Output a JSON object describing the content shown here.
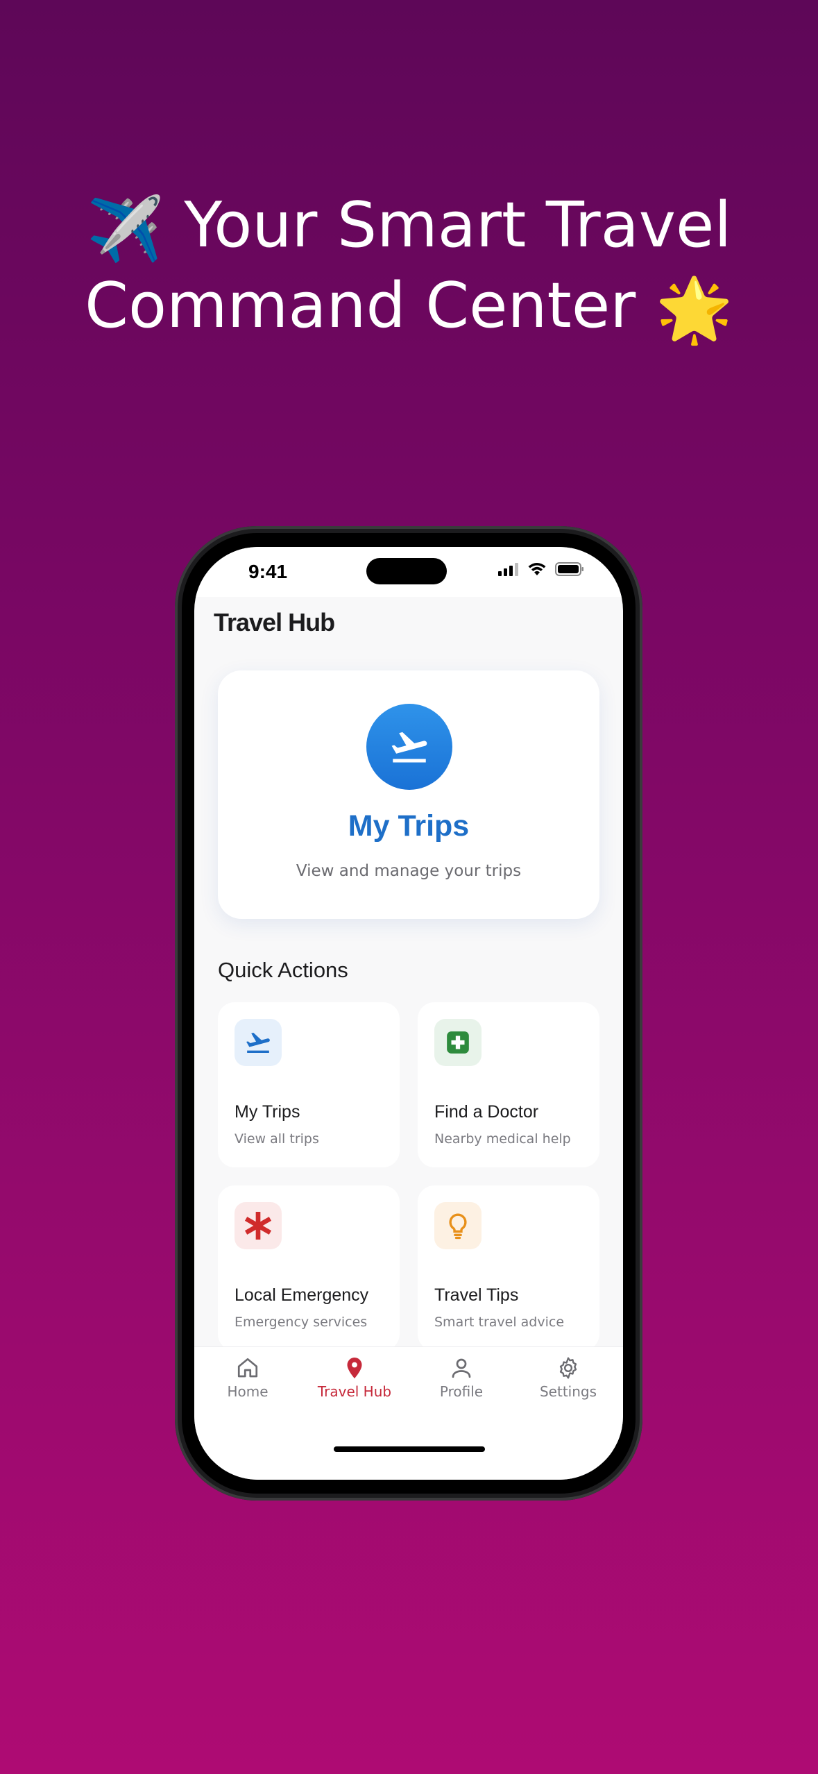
{
  "promo": {
    "headline_line1": "Your Smart Travel",
    "headline_line2": "Command Center",
    "emoji_start": "✈️",
    "emoji_end": "🌟"
  },
  "status_bar": {
    "time": "9:41"
  },
  "app": {
    "title": "Travel Hub"
  },
  "hero_card": {
    "title": "My Trips",
    "subtitle": "View and manage your trips",
    "icon": "airplane-departure-icon",
    "accent_color": "#1e6fc8"
  },
  "quick_actions": {
    "title": "Quick Actions",
    "items": [
      {
        "title": "My Trips",
        "subtitle": "View all trips",
        "icon": "airplane-departure-icon",
        "color": "#1e6fc8",
        "bg": "#e6f0fb"
      },
      {
        "title": "Find a Doctor",
        "subtitle": "Nearby medical help",
        "icon": "medical-cross-icon",
        "color": "#2e8b3d",
        "bg": "#e8f3ea"
      },
      {
        "title": "Local Emergency",
        "subtitle": "Emergency services",
        "icon": "asterisk-icon",
        "color": "#d02b2b",
        "bg": "#fbe9e9"
      },
      {
        "title": "Travel Tips",
        "subtitle": "Smart travel advice",
        "icon": "lightbulb-icon",
        "color": "#e8901a",
        "bg": "#fdf1e3"
      }
    ]
  },
  "tab_bar": {
    "tabs": [
      {
        "label": "Home",
        "icon": "home-icon",
        "active": false
      },
      {
        "label": "Travel Hub",
        "icon": "map-pin-icon",
        "active": true
      },
      {
        "label": "Profile",
        "icon": "person-icon",
        "active": false
      },
      {
        "label": "Settings",
        "icon": "gear-icon",
        "active": false
      }
    ],
    "active_color": "#c6293a"
  }
}
